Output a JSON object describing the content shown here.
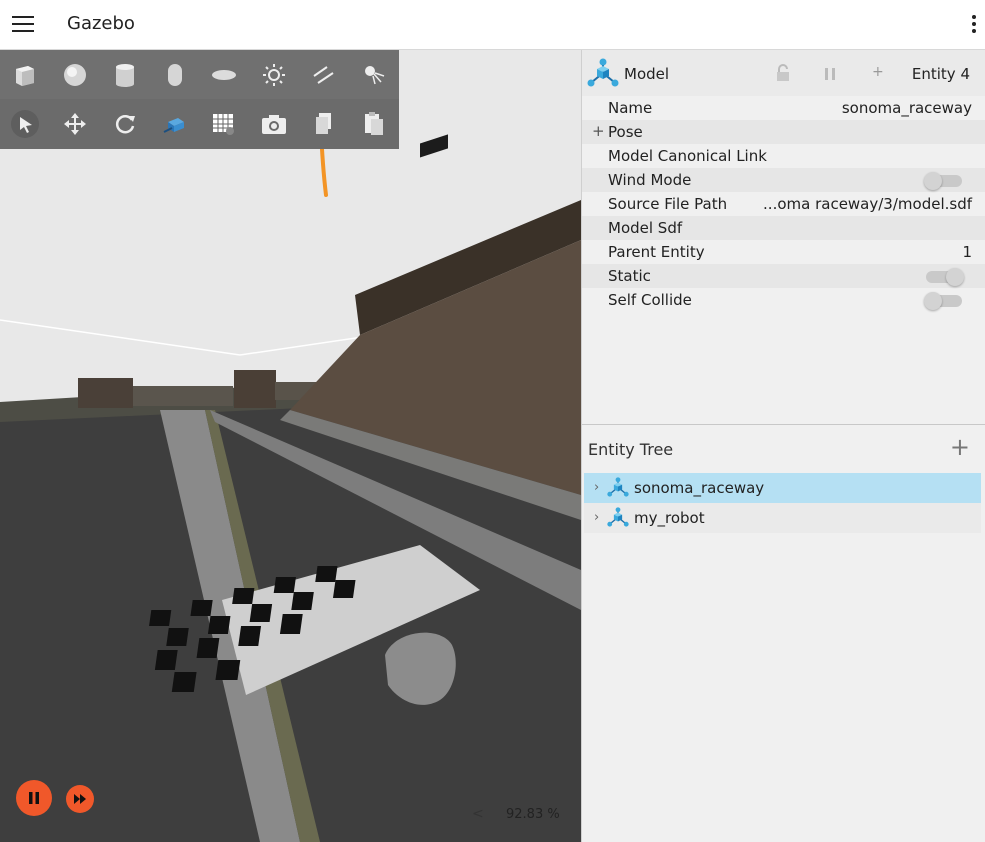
{
  "app": {
    "title": "Gazebo"
  },
  "toolbar": {
    "shapes": [
      "box-icon",
      "sphere-icon",
      "cylinder-icon",
      "capsule-icon",
      "ellipsoid-icon",
      "sun-light-icon",
      "directional-light-icon",
      "spot-light-icon"
    ],
    "tools": [
      "select-icon",
      "translate-icon",
      "rotate-icon",
      "transform-icon",
      "grid-icon",
      "camera-icon",
      "copy-icon",
      "paste-icon"
    ]
  },
  "playback": {
    "rtf": "92.83 %",
    "rtf_arrow": "<"
  },
  "component_inspector": {
    "type_label": "Model",
    "entity_label": "Entity 4",
    "plus_label": "+",
    "rows": {
      "name": {
        "key": "Name",
        "value": "sonoma_raceway"
      },
      "pose": {
        "key": "Pose",
        "expander": "+"
      },
      "canonical": {
        "key": "Model Canonical Link"
      },
      "wind": {
        "key": "Wind Mode",
        "value": "off"
      },
      "source": {
        "key": "Source File Path",
        "value": "...oma raceway/3/model.sdf"
      },
      "sdf": {
        "key": "Model Sdf"
      },
      "parent": {
        "key": "Parent Entity",
        "value": "1"
      },
      "static": {
        "key": "Static",
        "value": "on"
      },
      "self_collide": {
        "key": "Self Collide",
        "value": "off"
      }
    }
  },
  "entity_tree": {
    "title": "Entity Tree",
    "add_label": "+",
    "items": [
      {
        "label": "sonoma_raceway",
        "chevron": "›",
        "selected": true
      },
      {
        "label": "my_robot",
        "chevron": "›",
        "selected": false
      }
    ]
  },
  "colors": {
    "accent": "#f0582a",
    "selection": "#b5e0f3",
    "annotation_arrow": "#f39425"
  }
}
